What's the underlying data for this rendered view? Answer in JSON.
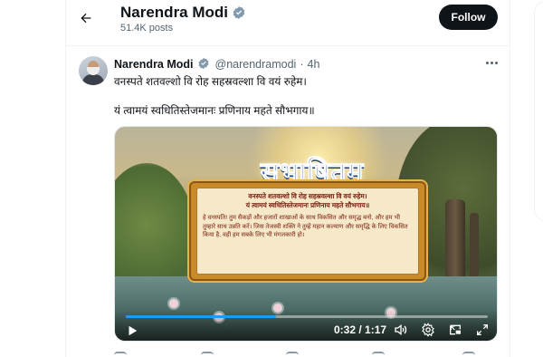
{
  "header": {
    "name": "Narendra Modi",
    "posts_count": "51.4K posts",
    "follow_label": "Follow"
  },
  "post": {
    "author_name": "Narendra Modi",
    "handle": "@narendramodi",
    "separator": "·",
    "time": "4h",
    "line1": "वनस्पते शतवल्शो वि रोह सहस्रवल्शा वि वयं रुहेम।",
    "line2": "यं त्वामयं स्वधितिस्तेजमानः प्रणिनाय महते सौभगाय॥"
  },
  "media": {
    "title": "सुभाषितम्",
    "verse1": "वनस्पते शतवल्शो वि रोह सहस्रवल्शा वि वयं रुहेम।",
    "verse2": "यं त्वामयं स्वधितिस्तेजमानः प्रणिनाय महते सौभगाय॥",
    "meaning": "हे वनस्पति! तुम सैकड़ों और हजारों शाखाओं के साथ विकसित और समृद्ध बनो, और हम भी तुम्हारे साथ उन्नति करें। जिस तेजस्वी शक्ति ने तुम्हें महान कल्याण और समृद्धि के लिए विकसित किया है, वही हम सबके लिए भी मंगलकारी हो।",
    "time_display": "0:32 / 1:17",
    "progress_fraction": 0.415
  },
  "icons": {
    "back": "arrow-left-icon",
    "verified": "verified-badge-icon",
    "more": "more-dots-icon",
    "play": "play-icon",
    "volume": "volume-icon",
    "settings": "gear-icon",
    "pip": "picture-in-picture-icon",
    "fullscreen": "fullscreen-icon"
  },
  "colors": {
    "accent": "#1d9bf0",
    "text_primary": "#0f1419",
    "text_secondary": "#536471",
    "follow_bg": "#0f1419"
  }
}
